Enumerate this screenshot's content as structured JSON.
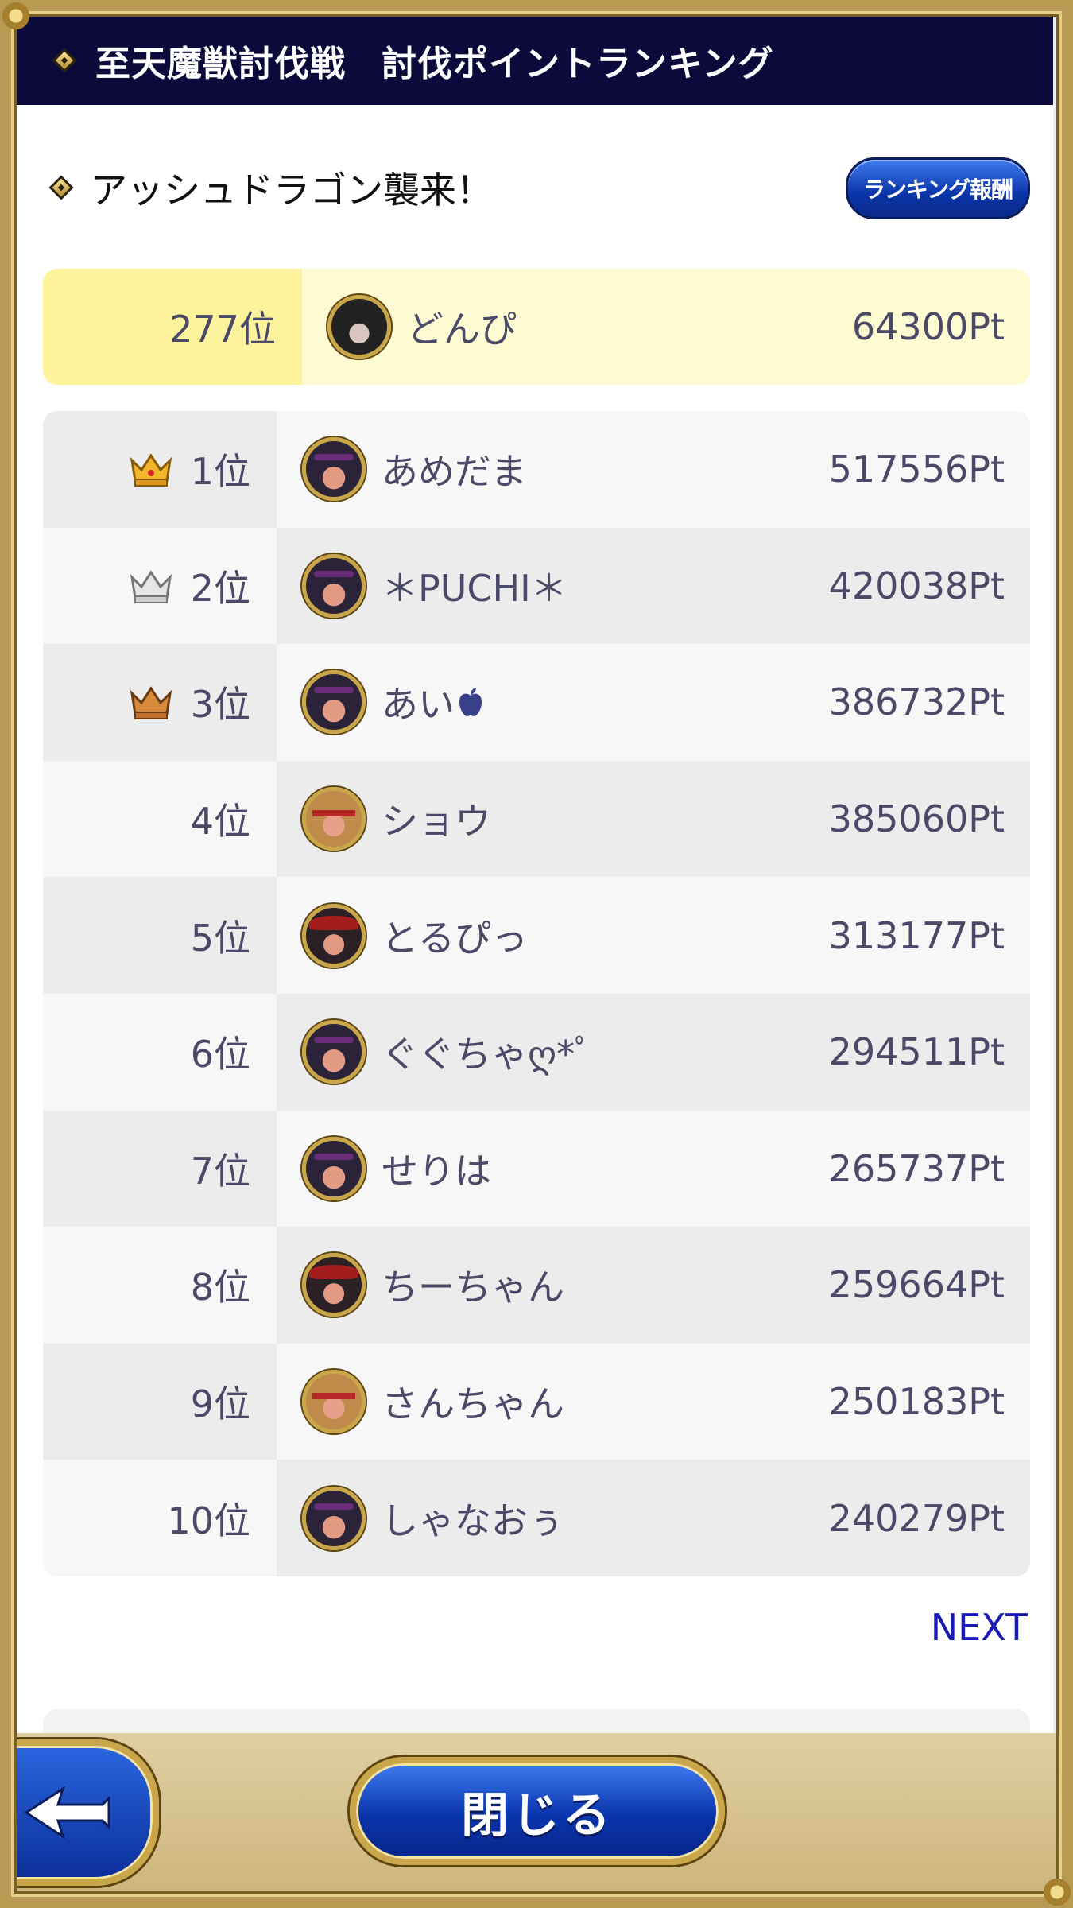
{
  "header": {
    "title": "至天魔獣討伐戦　討伐ポイントランキング"
  },
  "event": {
    "title": "アッシュドラゴン襲来！",
    "reward_button": "ランキング報酬"
  },
  "my_rank": {
    "rank": "277位",
    "name": "どんぴ",
    "points": "64300Pt"
  },
  "rankings": [
    {
      "rank": "1位",
      "name": "あめだま",
      "points": "517556Pt",
      "crown": "gold-crown-icon"
    },
    {
      "rank": "2位",
      "name": "＊PUCHI＊",
      "points": "420038Pt",
      "crown": "silver-crown-icon"
    },
    {
      "rank": "3位",
      "name": "あい",
      "points": "386732Pt",
      "crown": "bronze-crown-icon"
    },
    {
      "rank": "4位",
      "name": "ショウ",
      "points": "385060Pt"
    },
    {
      "rank": "5位",
      "name": "とるぴっ",
      "points": "313177Pt"
    },
    {
      "rank": "6位",
      "name": "ぐぐちゃღ*ﾟ",
      "points": "294511Pt"
    },
    {
      "rank": "7位",
      "name": "せりは",
      "points": "265737Pt"
    },
    {
      "rank": "8位",
      "name": "ちーちゃん",
      "points": "259664Pt"
    },
    {
      "rank": "9位",
      "name": "さんちゃん",
      "points": "250183Pt"
    },
    {
      "rank": "10位",
      "name": "しゃなおぅ",
      "points": "240279Pt"
    }
  ],
  "pagination": {
    "next": "NEXT"
  },
  "footer": {
    "close_label": "閉じる"
  },
  "colors": {
    "header_bg": "#0b0a3a",
    "my_rank_bg": "#fefbd3",
    "button_blue": "#0a34a8",
    "gold_frame": "#b89a52"
  }
}
